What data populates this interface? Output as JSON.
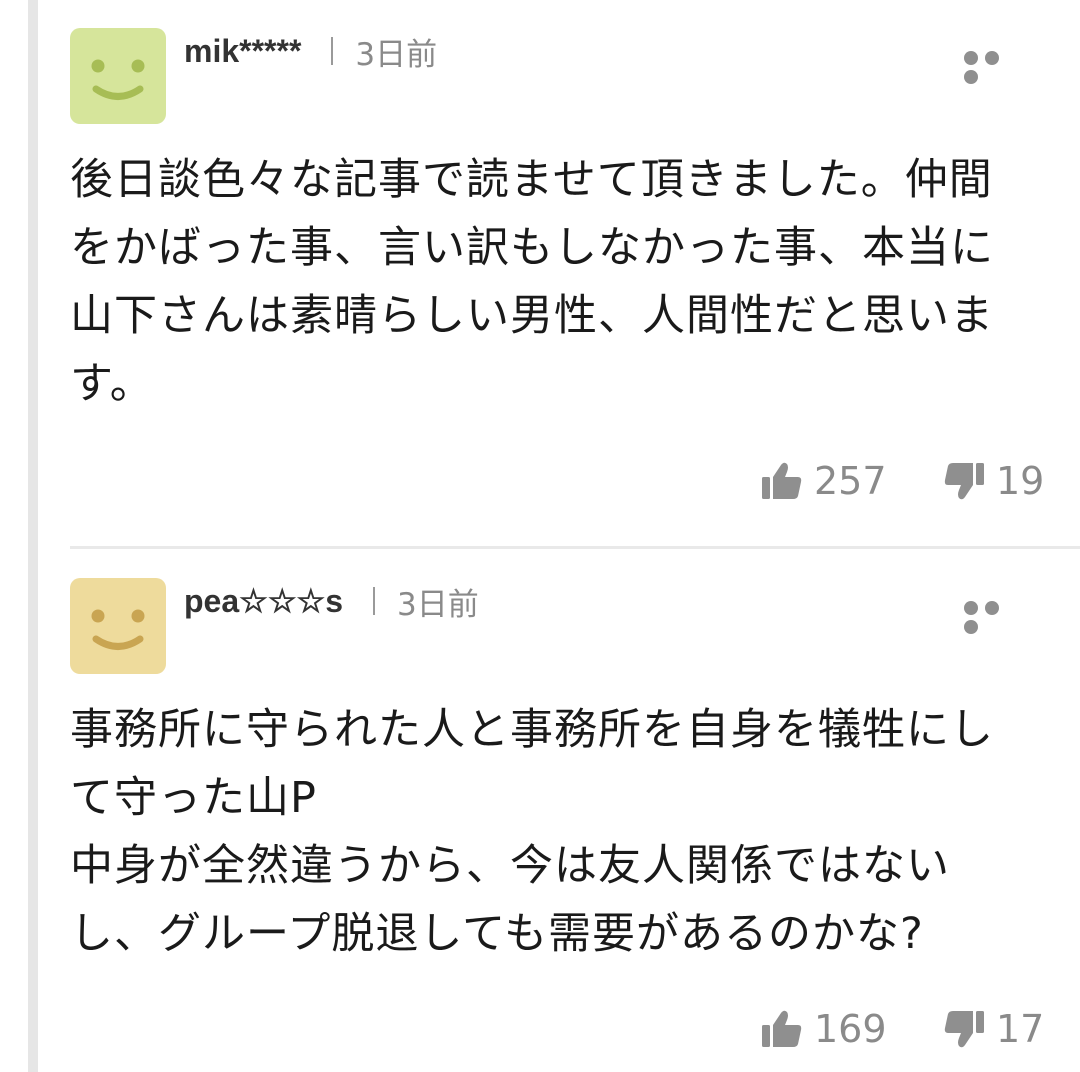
{
  "comments": [
    {
      "username": "mik*****",
      "time": "3日前",
      "avatar_color": "#d6e59b",
      "avatar_face_color": "#a7bd55",
      "avatar_icon": "smiley-face-icon",
      "text": "後日談色々な記事で読ませて頂きました。仲間\nをかばった事、言い訳もしなかった事、本当に\n山下さんは素晴らしい男性、人間性だと思いま\nす。",
      "likes": "257",
      "dislikes": "19"
    },
    {
      "username": "pea☆☆☆s",
      "time": "3日前",
      "avatar_color": "#eedb9c",
      "avatar_face_color": "#c9a552",
      "avatar_icon": "smiley-face-icon",
      "text": "事務所に守られた人と事務所を自身を犠牲にし\nて守った山P\n中身が全然違うから、今は友人関係ではない\nし、グループ脱退しても需要があるのかな?",
      "likes": "169",
      "dislikes": "17"
    }
  ]
}
